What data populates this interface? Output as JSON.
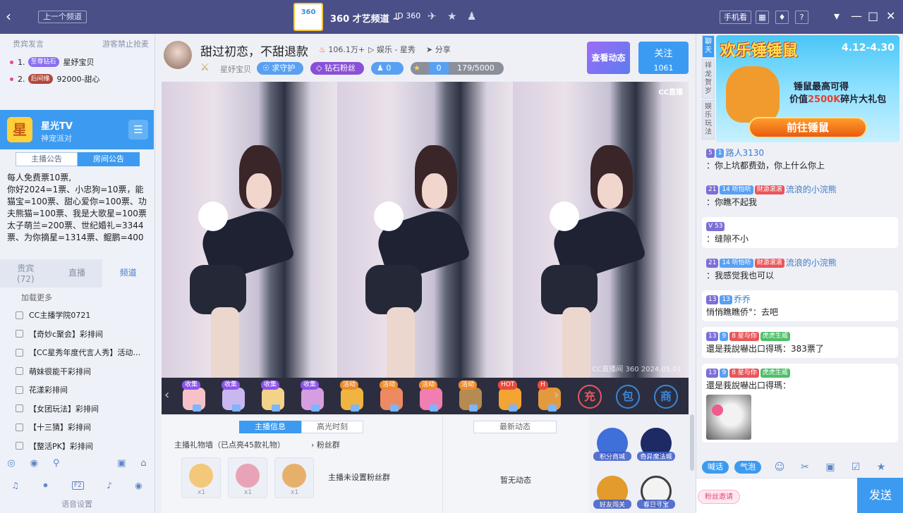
{
  "titlebar": {
    "back_icon": "chevron-left-icon",
    "prev_channel": "上一个频道",
    "channel_name": "360 才艺频道 ~",
    "channel_id": "ID 360",
    "mobile_watch": "手机看"
  },
  "left": {
    "head_left": "贵宾发言",
    "head_right": "游客禁止抢麦",
    "ranks": [
      {
        "num": "1.",
        "badge": "至尊钻石",
        "badge_color": "#8a6ff0",
        "name": "星妤宝贝"
      },
      {
        "num": "2.",
        "badge": "后间缘",
        "badge_color": "#b0473a",
        "name": "92000-甜心"
      }
    ],
    "star_name": "星光TV",
    "star_sub": "神宠派对",
    "notice_tabs": [
      "主播公告",
      "房间公告"
    ],
    "notice_lines": [
      "每人免费票10票,",
      "你好2024=1票、小忠狗=10票，能猫宝=100票、甜心爱你=100票、功夫熊猫=100票、我是大歌星=100票",
      "太子萌兰=200票、世纪婚礼=3344票、为你摘星=1314票、鲲鹏=400"
    ],
    "tabs": [
      "贵宾\n(72)",
      "直播",
      "频道"
    ],
    "load_more": "加载更多",
    "channels": [
      "CC主播学院0721",
      "【奇妙c聚会】彩排间",
      "【CC星秀年度代言人秀】活动…",
      "萌妹很能干彩排间",
      "花漾彩排间",
      "【女团玩法】彩排间",
      "【十三猜】彩排间",
      "【整活PK】彩排间"
    ],
    "voice_settings": "语音设置"
  },
  "room": {
    "title": "甜过初恋，不甜退款",
    "hot": "106.1万+",
    "category": "娱乐 - 星秀",
    "share": "分享",
    "anchor": "星妤宝贝",
    "guard": "求守护",
    "fans": "钻石粉丝",
    "count": "0",
    "level": "0",
    "progress": "179/5000",
    "dynamic_btn": "查看动态",
    "follow": "关注",
    "follow_count": "1061"
  },
  "video": {
    "logo": "CC直播",
    "watermark": "CC直播间 360 2024.05.01"
  },
  "gifts": [
    {
      "tag": "收集",
      "tag_color": "#8d54e8",
      "color": "#f6c2c8"
    },
    {
      "tag": "收集",
      "tag_color": "#8d54e8",
      "color": "#c9b7f0"
    },
    {
      "tag": "收集",
      "tag_color": "#8d54e8",
      "color": "#f3d28a"
    },
    {
      "tag": "收集",
      "tag_color": "#8d54e8",
      "color": "#d69ee0"
    },
    {
      "tag": "活动",
      "tag_color": "#f08a2a",
      "color": "#f2b441"
    },
    {
      "tag": "活动",
      "tag_color": "#f08a2a",
      "color": "#ed8a61"
    },
    {
      "tag": "活动",
      "tag_color": "#f08a2a",
      "color": "#f07eb0"
    },
    {
      "tag": "活动",
      "tag_color": "#f08a2a",
      "color": "#b58b52"
    },
    {
      "tag": "HOT",
      "tag_color": "#ea4a3a",
      "color": "#f3a432"
    },
    {
      "tag": "H",
      "tag_color": "#ea4a3a",
      "color": "#e39a3c"
    }
  ],
  "gift_icons": [
    {
      "glyph": "充",
      "color": "#e8565b"
    },
    {
      "glyph": "包",
      "color": "#3a86d8"
    },
    {
      "glyph": "商",
      "color": "#3a86d8"
    }
  ],
  "lower": {
    "tabs": [
      "主播信息",
      "高光时刻"
    ],
    "dyn_tab": "最新动态",
    "gift_wall": "主播礼物墙（已点亮45款礼物）",
    "fans_group": "粉丝群",
    "gift_counts": [
      "x1",
      "x1",
      "x1"
    ],
    "no_fans": "主播未设置粉丝群",
    "no_dyn": "暂无动态"
  },
  "apps": [
    {
      "label": "积分商城",
      "color": "#3f6fd8"
    },
    {
      "label": "奇异魔法城",
      "color": "#1e2a64"
    },
    {
      "label": "好友闯关",
      "color": "#e39b2c"
    },
    {
      "label": "春日寻宝",
      "color": "#3e3e3e"
    }
  ],
  "right": {
    "side_tabs": [
      "聊天",
      "祥龙贺岁",
      "娱乐玩法"
    ],
    "banner_title": "欢乐锤锤鼠",
    "banner_date": "4.12-4.30",
    "banner_line1": "锤鼠最高可得",
    "banner_line2_pre": "价值",
    "banner_line2_hl": "2500K",
    "banner_line2_post": "碎片大礼包",
    "banner_btn": "前往锤鼠",
    "messages": [
      {
        "badges": [
          "5",
          "1"
        ],
        "nick": "路人3130",
        "text": "：你上坑都费劲，你上什么你上",
        "card": false
      },
      {
        "badges": [
          "21",
          "14 听怡听",
          "财源滚滚"
        ],
        "nick": "流浪的小浣熊",
        "text": "：你瞧不起我",
        "card": false
      },
      {
        "badges": [
          "V 53"
        ],
        "nick": "",
        "text": "：缝隙不小",
        "card": true
      },
      {
        "badges": [
          "21",
          "14 听怡听",
          "财源滚滚"
        ],
        "nick": "流浪的小浣熊",
        "text": "：我感觉我也可以",
        "card": false
      },
      {
        "badges": [
          "13",
          "13"
        ],
        "nick": "乔乔",
        "text": "悄悄瞧瞧侨°：去吧",
        "card": true
      },
      {
        "badges": [
          "13",
          "9",
          "8 星与你",
          "虎虎生威"
        ],
        "nick": "",
        "text": "還是莪說嚇出口得瑪：383票了",
        "card": true
      },
      {
        "badges": [
          "13",
          "9",
          "8 星与你",
          "虎虎生威"
        ],
        "nick": "",
        "text": "還是莪說嚇出口得瑪：",
        "card": true,
        "image": true
      }
    ],
    "input_btns": [
      "喊话",
      "气泡"
    ],
    "fan_tag": "粉丝邀请",
    "send": "发送"
  }
}
